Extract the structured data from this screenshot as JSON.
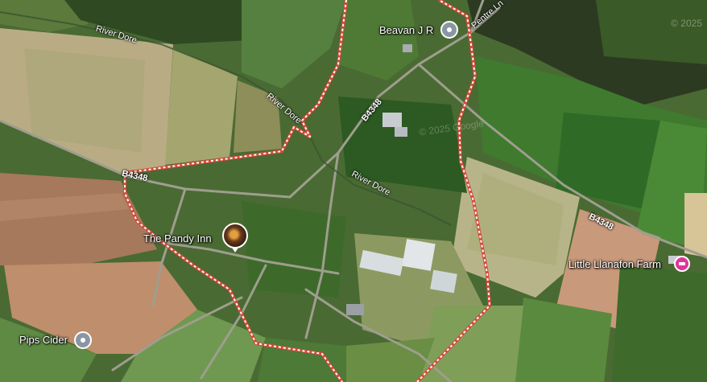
{
  "map": {
    "places": [
      {
        "id": "beavan",
        "label": "Beavan J R",
        "kind": "place"
      },
      {
        "id": "pandy",
        "label": "The Pandy Inn",
        "kind": "photo"
      },
      {
        "id": "pips",
        "label": "Pips Cider",
        "kind": "place"
      },
      {
        "id": "llanafon",
        "label": "Little Llanafon Farm",
        "kind": "lodging"
      }
    ],
    "roads": {
      "b4348_west": "B4348",
      "b4348_mid": "B4348",
      "b4348_east": "B4348",
      "pentre_ln": "Pentre Ln"
    },
    "rivers": {
      "river_1": "River Dore",
      "river_2": "River Dore",
      "river_3": "River Dore"
    },
    "watermarks": {
      "top_right": "© 2025",
      "center": "© 2025 Google"
    },
    "colors": {
      "route_outer": "#d44a3a",
      "route_inner": "#ffffff",
      "lodging_pin": "#e0339a",
      "place_pin": "#8a96a3"
    }
  }
}
